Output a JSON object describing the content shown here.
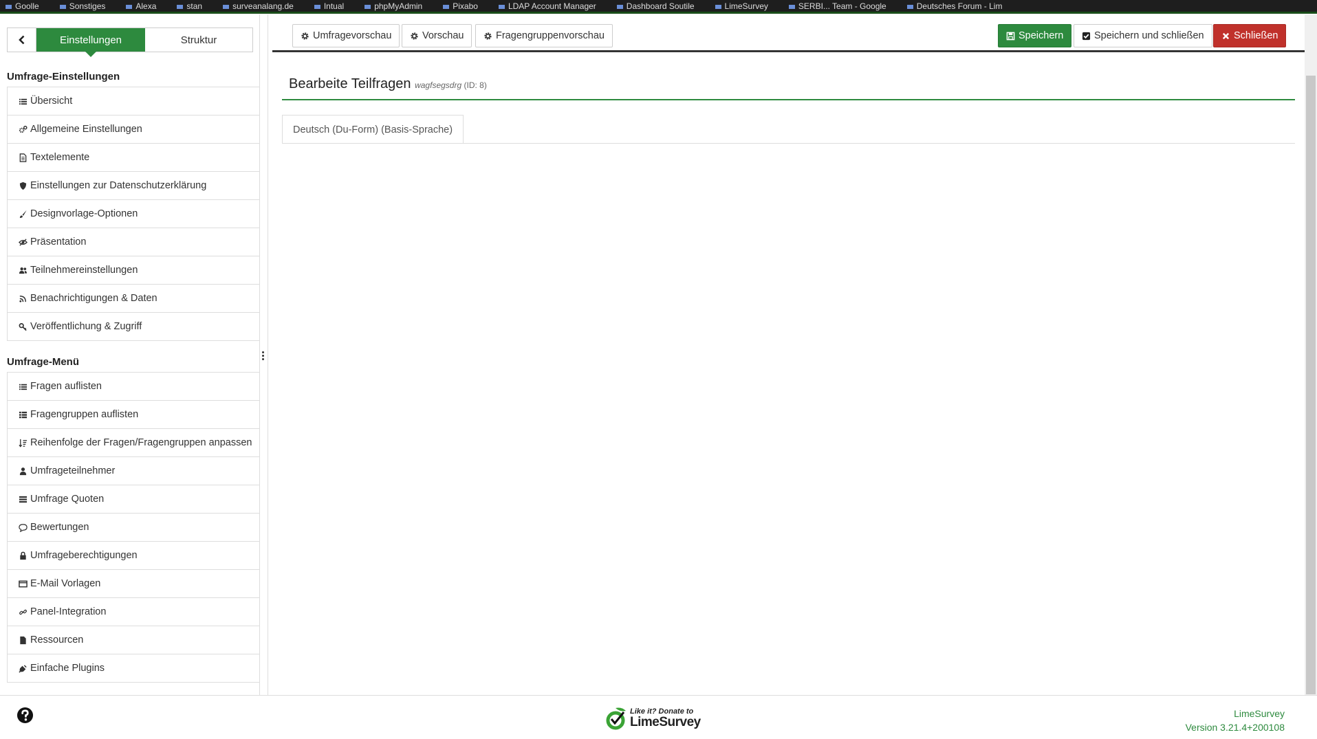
{
  "browser": {
    "bookmarks": [
      "Goolle",
      "Sonstiges",
      "Alexa",
      "stan",
      "surveanalang.de",
      "Intual",
      "phpMyAdmin",
      "Pixabo",
      "LDAP Account Manager",
      "Dashboard Soutile",
      "LimeSurvey",
      "SERBI... Team - Google",
      "Deutsches Forum - Lim"
    ]
  },
  "sidebar": {
    "tabs": {
      "settings": "Einstellungen",
      "structure": "Struktur"
    },
    "settings_title": "Umfrage-Einstellungen",
    "settings_items": [
      {
        "label": "Übersicht",
        "icon": "list-icon"
      },
      {
        "label": "Allgemeine Einstellungen",
        "icon": "gears-icon"
      },
      {
        "label": "Textelemente",
        "icon": "file-text-icon"
      },
      {
        "label": "Einstellungen zur Datenschutzerklärung",
        "icon": "shield-icon"
      },
      {
        "label": "Designvorlage-Optionen",
        "icon": "paint-brush-icon"
      },
      {
        "label": "Präsentation",
        "icon": "eye-slash-icon"
      },
      {
        "label": "Teilnehmereinstellungen",
        "icon": "users-icon"
      },
      {
        "label": "Benachrichtigungen & Daten",
        "icon": "rss-icon"
      },
      {
        "label": "Veröffentlichung & Zugriff",
        "icon": "key-icon"
      }
    ],
    "menu_title": "Umfrage-Menü",
    "menu_items": [
      {
        "label": "Fragen auflisten",
        "icon": "list-icon"
      },
      {
        "label": "Fragengruppen auflisten",
        "icon": "th-list-icon"
      },
      {
        "label": "Reihenfolge der Fragen/Fragengruppen anpassen",
        "icon": "sort-icon"
      },
      {
        "label": "Umfrageteilnehmer",
        "icon": "user-icon"
      },
      {
        "label": "Umfrage Quoten",
        "icon": "tasks-icon"
      },
      {
        "label": "Bewertungen",
        "icon": "comment-icon"
      },
      {
        "label": "Umfrageberechtigungen",
        "icon": "lock-icon"
      },
      {
        "label": "E-Mail Vorlagen",
        "icon": "envelope-icon"
      },
      {
        "label": "Panel-Integration",
        "icon": "link-icon"
      },
      {
        "label": "Ressourcen",
        "icon": "file-icon"
      },
      {
        "label": "Einfache Plugins",
        "icon": "plug-icon"
      }
    ]
  },
  "toolbar": {
    "survey_preview": "Umfragevorschau",
    "preview": "Vorschau",
    "group_preview": "Fragengruppenvorschau",
    "save": "Speichern",
    "save_close": "Speichern und schließen",
    "close": "Schließen"
  },
  "main": {
    "title": "Bearbeite Teilfragen",
    "survey_name": "wagfsegsdrg",
    "survey_id": "(ID: 8)",
    "language_tab": "Deutsch (Du-Form) (Basis-Sprache)"
  },
  "footer": {
    "donate_line1": "Like it? Donate to",
    "donate_brand": "LimeSurvey",
    "app_name": "LimeSurvey",
    "version": "Version 3.21.4+200108"
  },
  "colors": {
    "accent": "#2d8a3e",
    "danger": "#c0312b"
  }
}
